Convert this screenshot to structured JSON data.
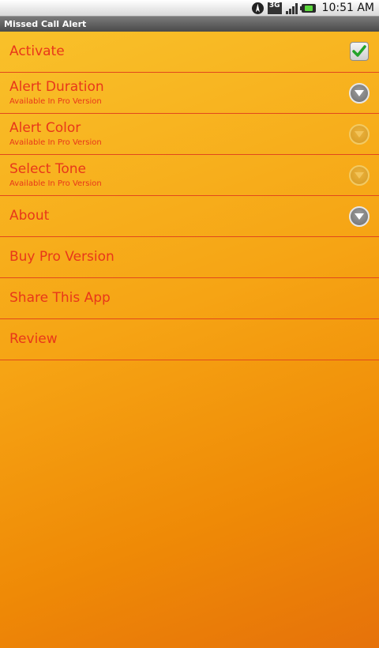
{
  "status_bar": {
    "network": "3G",
    "time": "10:51 AM",
    "icons": [
      "gps-icon",
      "network-3g-icon",
      "signal-icon",
      "battery-icon"
    ]
  },
  "title_bar": {
    "title": "Missed Call Alert"
  },
  "colors": {
    "text_red": "#e8371a",
    "divider": "#e2481c",
    "check_green": "#23a32a"
  },
  "menu": {
    "activate": {
      "label": "Activate",
      "checked": true
    },
    "alert_duration": {
      "label": "Alert Duration",
      "sub": "Available In Pro Version"
    },
    "alert_color": {
      "label": "Alert Color",
      "sub": "Available In Pro Version"
    },
    "select_tone": {
      "label": "Select Tone",
      "sub": "Available In Pro Version"
    },
    "about": {
      "label": "About"
    },
    "buy_pro": {
      "label": "Buy Pro Version"
    },
    "share": {
      "label": "Share This App"
    },
    "review": {
      "label": "Review"
    }
  }
}
